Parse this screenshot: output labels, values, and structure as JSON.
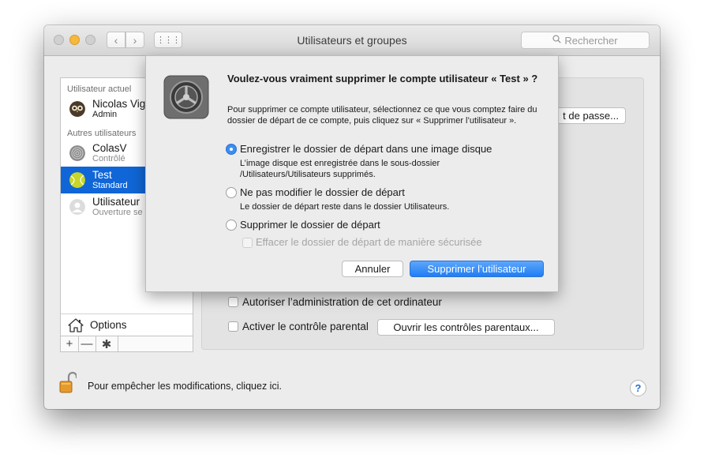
{
  "window": {
    "title": "Utilisateurs et groupes",
    "search_placeholder": "Rechercher",
    "nav_back": "‹",
    "nav_forward": "›",
    "grid": "⋮⋮⋮"
  },
  "sidebar": {
    "current_header": "Utilisateur actuel",
    "others_header": "Autres utilisateurs",
    "users": [
      {
        "name": "Nicolas Vig",
        "role": "Admin"
      },
      {
        "name": "ColasV",
        "role": "Contrôlé"
      },
      {
        "name": "Test",
        "role": "Standard"
      },
      {
        "name": "Utilisateur",
        "role": "Ouverture se"
      }
    ],
    "options_label": "Options",
    "plus": "+",
    "minus": "—",
    "gear": "✱"
  },
  "main": {
    "password_button": "t de passe...",
    "allow_admin_label": "Autoriser l’administration de cet ordinateur",
    "parental_label": "Activer le contrôle parental",
    "parental_button": "Ouvrir les contrôles parentaux..."
  },
  "footer": {
    "lock_text": "Pour empêcher les modifications, cliquez ici.",
    "help": "?"
  },
  "dialog": {
    "title": "Voulez-vous vraiment supprimer le compte utilisateur « Test » ?",
    "message": "Pour supprimer ce compte utilisateur, sélectionnez ce que vous comptez faire du dossier de départ de ce compte, puis cliquez sur « Supprimer l’utilisateur ».",
    "options": [
      {
        "label": "Enregistrer le dossier de départ dans une image disque",
        "description": "L’image disque est enregistrée dans le sous-dossier /Utilisateurs/Utilisateurs supprimés.",
        "selected": true
      },
      {
        "label": "Ne pas modifier le dossier de départ",
        "description": "Le dossier de départ reste dans le dossier Utilisateurs.",
        "selected": false
      },
      {
        "label": "Supprimer le dossier de départ",
        "description": "",
        "selected": false
      }
    ],
    "secure_erase_label": "Effacer le dossier de départ de manière sécurisée",
    "cancel_label": "Annuler",
    "delete_label": "Supprimer l’utilisateur"
  },
  "colors": {
    "selection": "#1066d6",
    "primary_button": "#1f7ef4",
    "minimize": "#f6b83d"
  }
}
